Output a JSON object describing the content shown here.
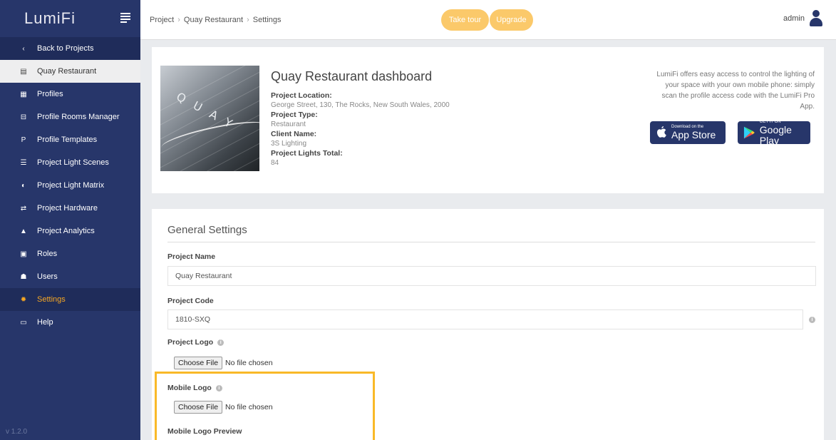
{
  "sidebar": {
    "brand": "LumiFi",
    "version": "v 1.2.0",
    "items": [
      {
        "label": "Back to Projects",
        "icon": "‹"
      },
      {
        "label": "Quay Restaurant",
        "icon": "▤"
      },
      {
        "label": "Profiles",
        "icon": "▦"
      },
      {
        "label": "Profile Rooms Manager",
        "icon": "⊟"
      },
      {
        "label": "Profile Templates",
        "icon": "P"
      },
      {
        "label": "Project Light Scenes",
        "icon": "☰"
      },
      {
        "label": "Project Light Matrix",
        "icon": "◐"
      },
      {
        "label": "Project Hardware",
        "icon": "⇄"
      },
      {
        "label": "Project Analytics",
        "icon": "▲"
      },
      {
        "label": "Roles",
        "icon": "▣"
      },
      {
        "label": "Users",
        "icon": "☗"
      },
      {
        "label": "Settings",
        "icon": "✹"
      },
      {
        "label": "Help",
        "icon": "▭"
      }
    ]
  },
  "topbar": {
    "breadcrumb": [
      "Project",
      "Quay Restaurant",
      "Settings"
    ],
    "take_tour": "Take tour",
    "upgrade": "Upgrade",
    "user": "admin"
  },
  "dashboard": {
    "image_text": "QUAY",
    "title": "Quay Restaurant dashboard",
    "location_label": "Project Location:",
    "location": "George Street, 130, The Rocks, New South Wales, 2000",
    "type_label": "Project Type:",
    "type": "Restaurant",
    "client_label": "Client Name:",
    "client": "3S Lighting",
    "lights_label": "Project Lights Total:",
    "lights": "84",
    "promo": "LumiFi offers easy access to control the lighting of your space with your own mobile phone: simply scan the profile access code with the LumiFi Pro App.",
    "app_store_small": "Download on the",
    "app_store_big": "App Store",
    "google_small": "GET IT ON",
    "google_big": "Google Play"
  },
  "settings": {
    "title": "General Settings",
    "project_name_label": "Project Name",
    "project_name": "Quay Restaurant",
    "project_code_label": "Project Code",
    "project_code": "1810-SXQ",
    "project_logo_label": "Project Logo",
    "mobile_logo_label": "Mobile Logo",
    "choose_file": "Choose File",
    "no_file": "No file chosen",
    "mobile_logo_preview_label": "Mobile Logo Preview"
  },
  "colors": {
    "sidebar": "#27366a",
    "accent": "#fbc96a",
    "active": "#f5a623",
    "highlight": "#f9b928"
  }
}
